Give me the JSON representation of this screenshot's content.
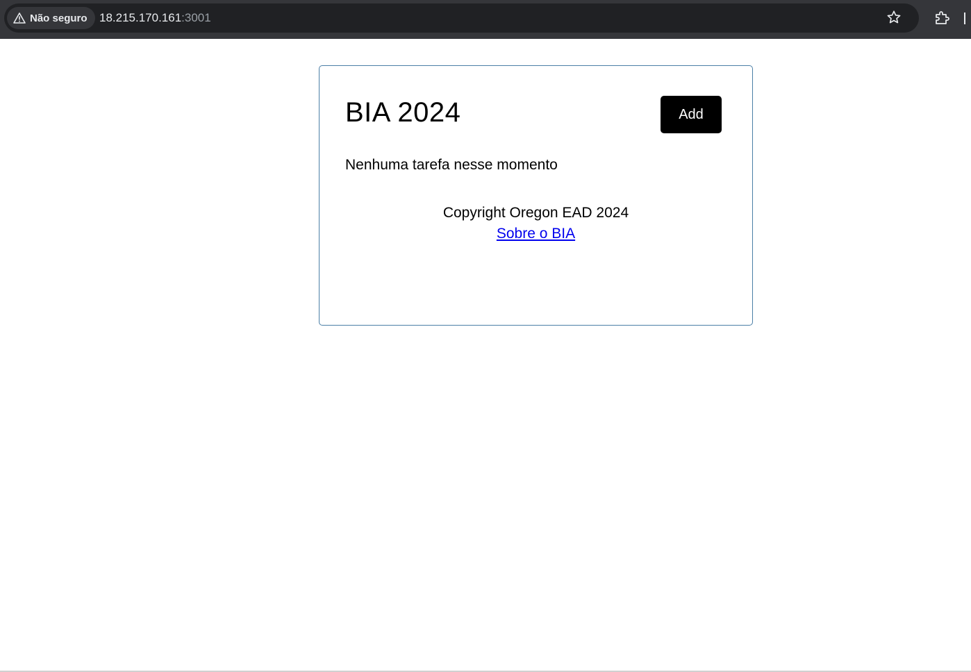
{
  "browser": {
    "security_label": "Não seguro",
    "url_host": "18.215.170.161",
    "url_port": ":3001",
    "icons": [
      "warning-icon",
      "star-icon",
      "extensions-icon"
    ]
  },
  "app": {
    "title": "BIA 2024",
    "add_button_label": "Add",
    "empty_message": "Nenhuma tarefa nesse momento",
    "copyright": "Copyright Oregon EAD 2024",
    "about_link": "Sobre o BIA"
  },
  "colors": {
    "card_border": "#4a7ea6",
    "button_bg": "#000000",
    "link": "#0000ee"
  }
}
